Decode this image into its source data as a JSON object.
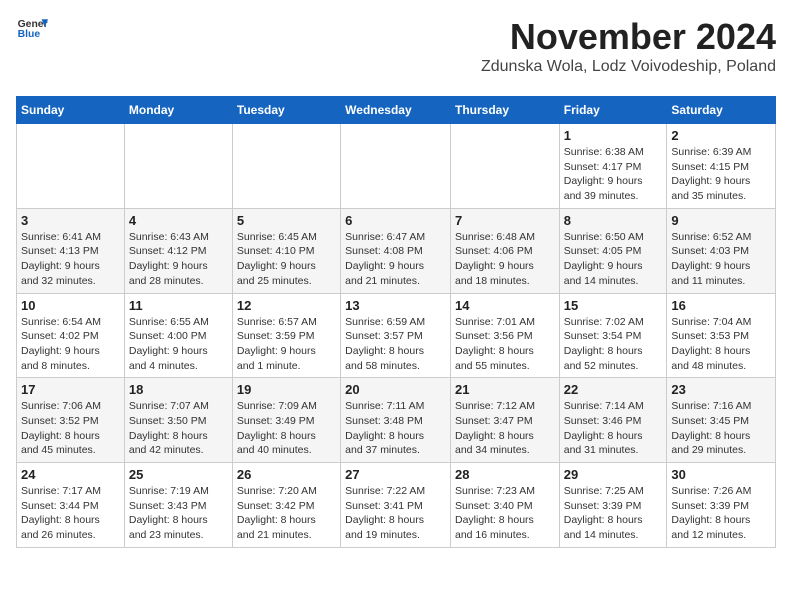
{
  "header": {
    "logo_line1": "General",
    "logo_line2": "Blue",
    "month_title": "November 2024",
    "location": "Zdunska Wola, Lodz Voivodeship, Poland"
  },
  "weekdays": [
    "Sunday",
    "Monday",
    "Tuesday",
    "Wednesday",
    "Thursday",
    "Friday",
    "Saturday"
  ],
  "weeks": [
    [
      {
        "day": "",
        "info": ""
      },
      {
        "day": "",
        "info": ""
      },
      {
        "day": "",
        "info": ""
      },
      {
        "day": "",
        "info": ""
      },
      {
        "day": "",
        "info": ""
      },
      {
        "day": "1",
        "info": "Sunrise: 6:38 AM\nSunset: 4:17 PM\nDaylight: 9 hours\nand 39 minutes."
      },
      {
        "day": "2",
        "info": "Sunrise: 6:39 AM\nSunset: 4:15 PM\nDaylight: 9 hours\nand 35 minutes."
      }
    ],
    [
      {
        "day": "3",
        "info": "Sunrise: 6:41 AM\nSunset: 4:13 PM\nDaylight: 9 hours\nand 32 minutes."
      },
      {
        "day": "4",
        "info": "Sunrise: 6:43 AM\nSunset: 4:12 PM\nDaylight: 9 hours\nand 28 minutes."
      },
      {
        "day": "5",
        "info": "Sunrise: 6:45 AM\nSunset: 4:10 PM\nDaylight: 9 hours\nand 25 minutes."
      },
      {
        "day": "6",
        "info": "Sunrise: 6:47 AM\nSunset: 4:08 PM\nDaylight: 9 hours\nand 21 minutes."
      },
      {
        "day": "7",
        "info": "Sunrise: 6:48 AM\nSunset: 4:06 PM\nDaylight: 9 hours\nand 18 minutes."
      },
      {
        "day": "8",
        "info": "Sunrise: 6:50 AM\nSunset: 4:05 PM\nDaylight: 9 hours\nand 14 minutes."
      },
      {
        "day": "9",
        "info": "Sunrise: 6:52 AM\nSunset: 4:03 PM\nDaylight: 9 hours\nand 11 minutes."
      }
    ],
    [
      {
        "day": "10",
        "info": "Sunrise: 6:54 AM\nSunset: 4:02 PM\nDaylight: 9 hours\nand 8 minutes."
      },
      {
        "day": "11",
        "info": "Sunrise: 6:55 AM\nSunset: 4:00 PM\nDaylight: 9 hours\nand 4 minutes."
      },
      {
        "day": "12",
        "info": "Sunrise: 6:57 AM\nSunset: 3:59 PM\nDaylight: 9 hours\nand 1 minute."
      },
      {
        "day": "13",
        "info": "Sunrise: 6:59 AM\nSunset: 3:57 PM\nDaylight: 8 hours\nand 58 minutes."
      },
      {
        "day": "14",
        "info": "Sunrise: 7:01 AM\nSunset: 3:56 PM\nDaylight: 8 hours\nand 55 minutes."
      },
      {
        "day": "15",
        "info": "Sunrise: 7:02 AM\nSunset: 3:54 PM\nDaylight: 8 hours\nand 52 minutes."
      },
      {
        "day": "16",
        "info": "Sunrise: 7:04 AM\nSunset: 3:53 PM\nDaylight: 8 hours\nand 48 minutes."
      }
    ],
    [
      {
        "day": "17",
        "info": "Sunrise: 7:06 AM\nSunset: 3:52 PM\nDaylight: 8 hours\nand 45 minutes."
      },
      {
        "day": "18",
        "info": "Sunrise: 7:07 AM\nSunset: 3:50 PM\nDaylight: 8 hours\nand 42 minutes."
      },
      {
        "day": "19",
        "info": "Sunrise: 7:09 AM\nSunset: 3:49 PM\nDaylight: 8 hours\nand 40 minutes."
      },
      {
        "day": "20",
        "info": "Sunrise: 7:11 AM\nSunset: 3:48 PM\nDaylight: 8 hours\nand 37 minutes."
      },
      {
        "day": "21",
        "info": "Sunrise: 7:12 AM\nSunset: 3:47 PM\nDaylight: 8 hours\nand 34 minutes."
      },
      {
        "day": "22",
        "info": "Sunrise: 7:14 AM\nSunset: 3:46 PM\nDaylight: 8 hours\nand 31 minutes."
      },
      {
        "day": "23",
        "info": "Sunrise: 7:16 AM\nSunset: 3:45 PM\nDaylight: 8 hours\nand 29 minutes."
      }
    ],
    [
      {
        "day": "24",
        "info": "Sunrise: 7:17 AM\nSunset: 3:44 PM\nDaylight: 8 hours\nand 26 minutes."
      },
      {
        "day": "25",
        "info": "Sunrise: 7:19 AM\nSunset: 3:43 PM\nDaylight: 8 hours\nand 23 minutes."
      },
      {
        "day": "26",
        "info": "Sunrise: 7:20 AM\nSunset: 3:42 PM\nDaylight: 8 hours\nand 21 minutes."
      },
      {
        "day": "27",
        "info": "Sunrise: 7:22 AM\nSunset: 3:41 PM\nDaylight: 8 hours\nand 19 minutes."
      },
      {
        "day": "28",
        "info": "Sunrise: 7:23 AM\nSunset: 3:40 PM\nDaylight: 8 hours\nand 16 minutes."
      },
      {
        "day": "29",
        "info": "Sunrise: 7:25 AM\nSunset: 3:39 PM\nDaylight: 8 hours\nand 14 minutes."
      },
      {
        "day": "30",
        "info": "Sunrise: 7:26 AM\nSunset: 3:39 PM\nDaylight: 8 hours\nand 12 minutes."
      }
    ]
  ]
}
